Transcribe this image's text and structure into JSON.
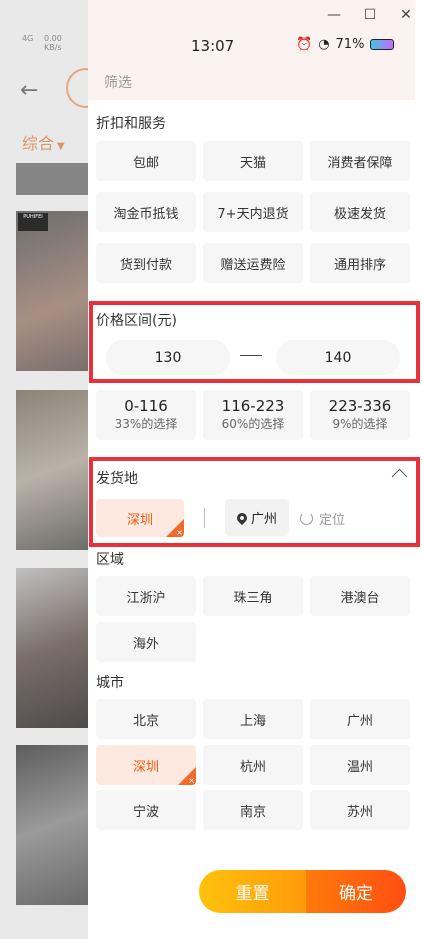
{
  "window": {
    "minimize": "—",
    "maximize": "☐",
    "close": "✕"
  },
  "background": {
    "signal": "4G",
    "speed": "0.00\nKB/s",
    "back_arrow": "←",
    "sort_label": "综合",
    "sort_arrow": "▼",
    "product_tag": "PUHIFEI"
  },
  "status_bar": {
    "time": "13:07",
    "battery": "71%"
  },
  "drawer": {
    "title": "筛选",
    "services": {
      "title": "折扣和服务",
      "items": [
        "包邮",
        "天猫",
        "消费者保障",
        "淘金币抵钱",
        "7+天内退货",
        "极速发货",
        "货到付款",
        "赠送运费险",
        "通用排序"
      ]
    },
    "price": {
      "title": "价格区间(元)",
      "min": "130",
      "max": "140",
      "ranges": [
        {
          "range": "0-116",
          "pct": "33%的选择"
        },
        {
          "range": "116-223",
          "pct": "60%的选择"
        },
        {
          "range": "223-336",
          "pct": "9%的选择"
        }
      ]
    },
    "shipping": {
      "title": "发货地",
      "selected": "深圳",
      "current_location": "广州",
      "locate_label": "定位"
    },
    "region": {
      "title": "区域",
      "items": [
        "江浙沪",
        "珠三角",
        "港澳台",
        "海外"
      ]
    },
    "city": {
      "title": "城市",
      "items": [
        "北京",
        "上海",
        "广州",
        "深圳",
        "杭州",
        "温州",
        "宁波",
        "南京",
        "苏州"
      ],
      "selected": "深圳"
    },
    "footer": {
      "reset": "重置",
      "confirm": "确定"
    }
  },
  "colors": {
    "accent": "#f55a10",
    "highlight_box": "#e8313a",
    "selected_bg": "#fde9df"
  }
}
